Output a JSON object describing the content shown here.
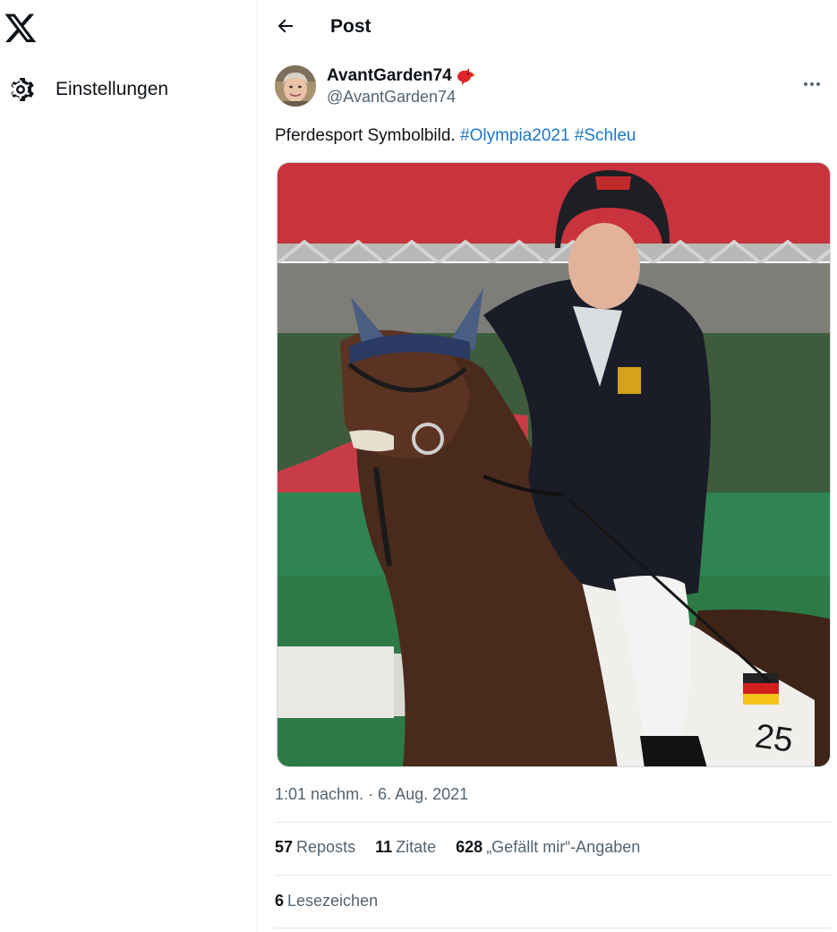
{
  "sidebar": {
    "logo_icon": "x-logo-icon",
    "settings_label": "Einstellungen",
    "settings_icon": "gear-icon"
  },
  "header": {
    "back_icon": "arrow-left-icon",
    "title": "Post"
  },
  "post": {
    "author": {
      "display_name": "AvantGarden74",
      "badge_icon": "red-bird-icon",
      "handle": "@AvantGarden74"
    },
    "more_icon": "more-dots-icon",
    "text_plain": "Pferdesport Symbolbild. ",
    "hashtags": [
      "#Olympia2021",
      "#Schleu"
    ],
    "media": {
      "kind": "photo",
      "saddle_pad_number": "25"
    },
    "timestamp": "1:01 nachm. · 6. Aug. 2021",
    "stats": {
      "reposts_count": "57",
      "reposts_label": "Reposts",
      "quotes_count": "11",
      "quotes_label": "Zitate",
      "likes_count": "628",
      "likes_label": "„Gefällt mir“-Angaben"
    },
    "bookmarks_count": "6",
    "bookmarks_label": "Lesezeichen"
  },
  "colors": {
    "hashtag": "#1d77c6",
    "secondary_text": "#536471",
    "badge_red": "#e0252b"
  }
}
